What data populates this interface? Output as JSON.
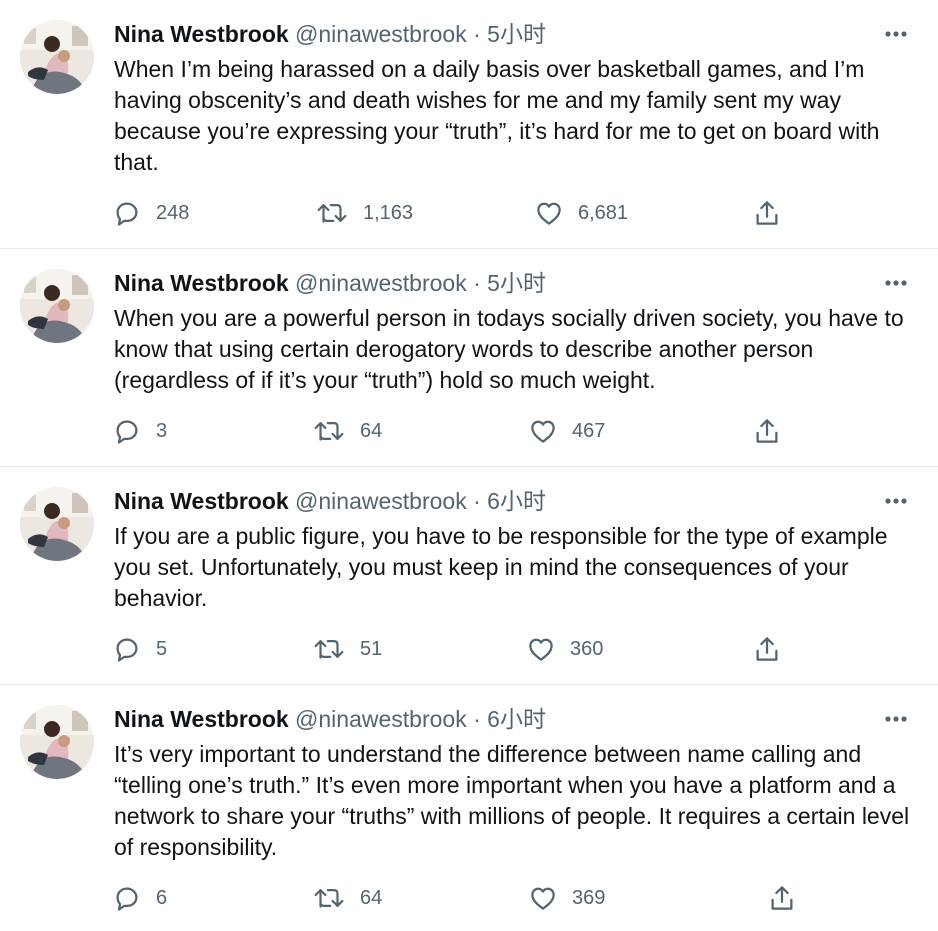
{
  "tweets": [
    {
      "author": "Nina Westbrook",
      "handle": "@ninawestbrook",
      "separator": "·",
      "time": "5小时",
      "text": "When I’m being harassed on a daily basis over basketball games, and I’m having obscenity’s and death wishes for me and my family sent my way because you’re expressing your “truth”, it’s hard for me to get on board with that.",
      "replies": "248",
      "retweets": "1,163",
      "likes": "6,681"
    },
    {
      "author": "Nina Westbrook",
      "handle": "@ninawestbrook",
      "separator": "·",
      "time": "5小时",
      "text": "When you are a powerful person in todays socially driven society, you have to know that using certain derogatory words to describe another person (regardless of if it’s your “truth”) hold so much weight.",
      "replies": "3",
      "retweets": "64",
      "likes": "467"
    },
    {
      "author": "Nina Westbrook",
      "handle": "@ninawestbrook",
      "separator": "·",
      "time": "6小时",
      "text": "If you are a public figure, you have to be responsible for the type of example you set. Unfortunately, you must keep in mind the consequences of your behavior.",
      "replies": "5",
      "retweets": "51",
      "likes": "360"
    },
    {
      "author": "Nina Westbrook",
      "handle": "@ninawestbrook",
      "separator": "·",
      "time": "6小时",
      "text": "It’s very important to understand the difference between name calling and “telling one’s truth.” It’s even more important when you have a platform and a network to share your “truths” with millions of people. It requires a certain level of responsibility.",
      "replies": "6",
      "retweets": "64",
      "likes": "369"
    }
  ],
  "icons": {
    "reply": "reply-icon",
    "retweet": "retweet-icon",
    "like": "like-icon",
    "share": "share-icon",
    "more": "more-icon"
  },
  "colors": {
    "text": "#0f1419",
    "secondary": "#536471",
    "divider": "#e6ecf0"
  }
}
